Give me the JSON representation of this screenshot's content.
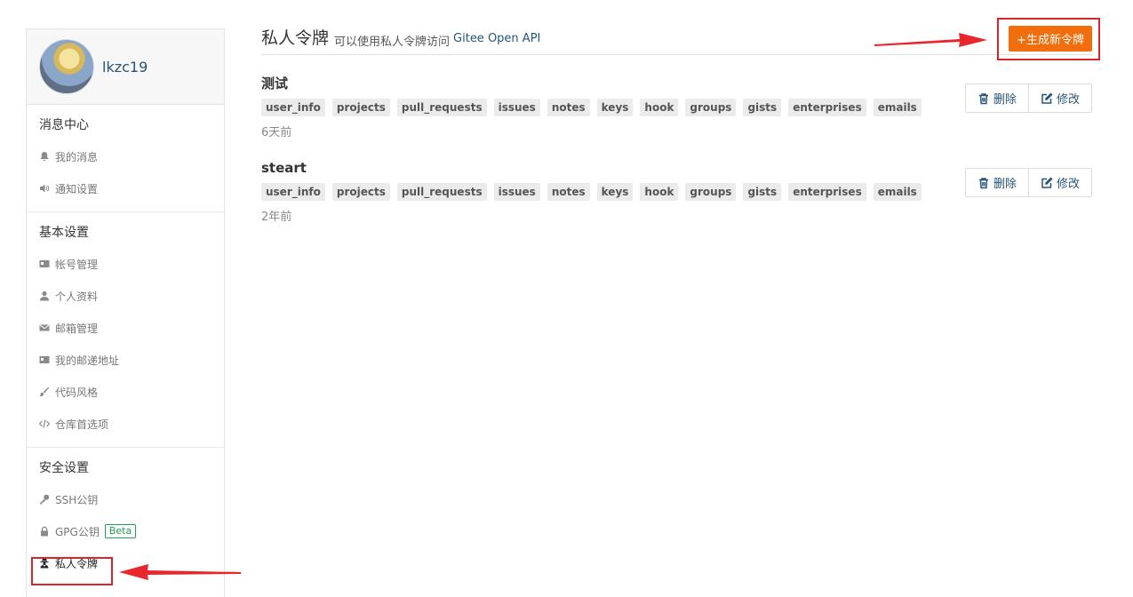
{
  "sidebar": {
    "username": "lkzc19",
    "sections": [
      {
        "title": "消息中心",
        "items": [
          {
            "label": "我的消息",
            "icon": "bell-icon"
          },
          {
            "label": "通知设置",
            "icon": "volume-icon"
          }
        ]
      },
      {
        "title": "基本设置",
        "items": [
          {
            "label": "帐号管理",
            "icon": "id-card-icon"
          },
          {
            "label": "个人资料",
            "icon": "user-icon"
          },
          {
            "label": "邮箱管理",
            "icon": "envelope-icon"
          },
          {
            "label": "我的邮递地址",
            "icon": "address-card-icon"
          },
          {
            "label": "代码风格",
            "icon": "brush-icon"
          },
          {
            "label": "仓库首选项",
            "icon": "code-icon"
          }
        ]
      },
      {
        "title": "安全设置",
        "items": [
          {
            "label": "SSH公钥",
            "icon": "key-icon"
          },
          {
            "label": "GPG公钥",
            "icon": "lock-icon",
            "badge": "Beta"
          },
          {
            "label": "私人令牌",
            "icon": "user-secret-icon",
            "active": true
          }
        ]
      }
    ]
  },
  "main": {
    "title": "私人令牌",
    "subtitle": "可以使用私人令牌访问",
    "api_link": "Gitee Open API",
    "new_button": "+生成新令牌",
    "delete_label": "删除",
    "edit_label": "修改",
    "tokens": [
      {
        "name": "测试",
        "scopes": [
          "user_info",
          "projects",
          "pull_requests",
          "issues",
          "notes",
          "keys",
          "hook",
          "groups",
          "gists",
          "enterprises",
          "emails"
        ],
        "time": "6天前"
      },
      {
        "name": "steart",
        "scopes": [
          "user_info",
          "projects",
          "pull_requests",
          "issues",
          "notes",
          "keys",
          "hook",
          "groups",
          "gists",
          "enterprises",
          "emails"
        ],
        "time": "2年前"
      }
    ]
  },
  "colors": {
    "accent": "#f26e0c",
    "link": "#25557a",
    "highlight": "#d9262c",
    "beta": "#21a150"
  }
}
